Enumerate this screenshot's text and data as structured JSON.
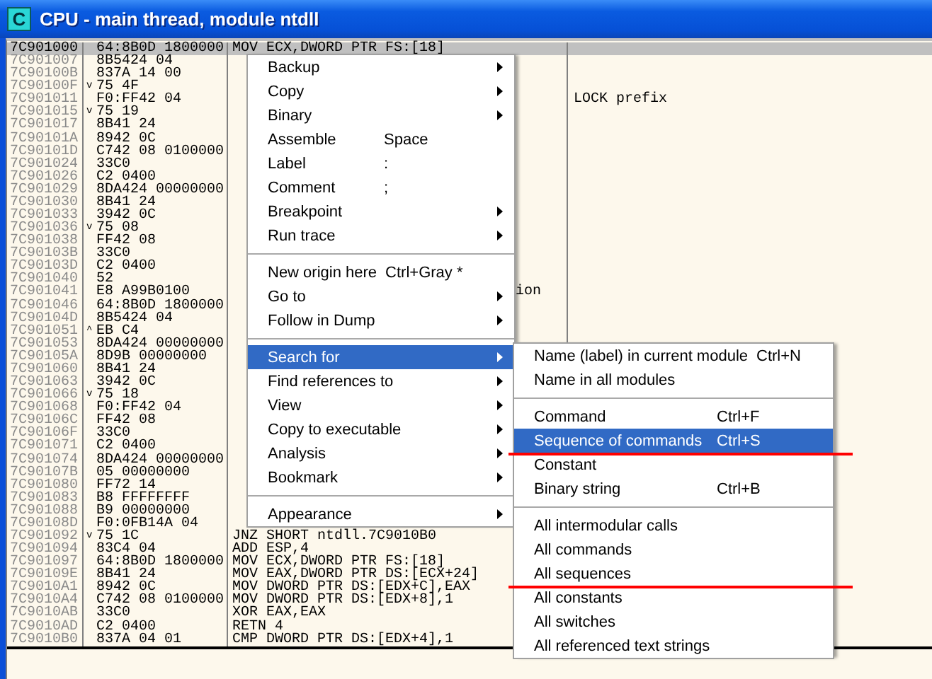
{
  "window": {
    "icon_letter": "C",
    "title": "CPU - main thread, module ntdll"
  },
  "rows": [
    {
      "addr": "7C901000",
      "hex": "64:8B0D 1800000",
      "disasm": "MOV ECX,DWORD PTR FS:[18]",
      "selected": true
    },
    {
      "addr": "7C901007",
      "hex": "8B5424 04",
      "selected": false
    },
    {
      "addr": "7C90100B",
      "hex": "837A 14 00",
      "selected": false
    },
    {
      "addr": "7C90100F",
      "hex": "75 4F",
      "jump": "v",
      "selected": false
    },
    {
      "addr": "7C901011",
      "hex": "F0:FF42 04",
      "comment": "LOCK prefix",
      "selected": false
    },
    {
      "addr": "7C901015",
      "hex": "75 19",
      "jump": "v",
      "selected": false
    },
    {
      "addr": "7C901017",
      "hex": "8B41 24",
      "selected": false
    },
    {
      "addr": "7C90101A",
      "hex": "8942 0C",
      "selected": false
    },
    {
      "addr": "7C90101D",
      "hex": "C742 08 0100000",
      "selected": false
    },
    {
      "addr": "7C901024",
      "hex": "33C0",
      "selected": false
    },
    {
      "addr": "7C901026",
      "hex": "C2 0400",
      "selected": false
    },
    {
      "addr": "7C901029",
      "hex": "8DA424 00000000",
      "selected": false
    },
    {
      "addr": "7C901030",
      "hex": "8B41 24",
      "selected": false
    },
    {
      "addr": "7C901033",
      "hex": "3942 0C",
      "selected": false
    },
    {
      "addr": "7C901036",
      "hex": "75 08",
      "jump": "v",
      "selected": false
    },
    {
      "addr": "7C901038",
      "hex": "FF42 08",
      "selected": false
    },
    {
      "addr": "7C90103B",
      "hex": "33C0",
      "selected": false
    },
    {
      "addr": "7C90103D",
      "hex": "C2 0400",
      "selected": false
    },
    {
      "addr": "7C901040",
      "hex": "52",
      "selected": false
    },
    {
      "addr": "7C901041",
      "hex": "E8 A99B0100",
      "disasm": "ion",
      "disasm_cut": true,
      "selected": false
    },
    {
      "addr": "7C901046",
      "hex": "64:8B0D 1800000",
      "selected": false
    },
    {
      "addr": "7C90104D",
      "hex": "8B5424 04",
      "selected": false
    },
    {
      "addr": "7C901051",
      "hex": "EB C4",
      "jump": "^",
      "selected": false
    },
    {
      "addr": "7C901053",
      "hex": "8DA424 00000000",
      "selected": false
    },
    {
      "addr": "7C90105A",
      "hex": "8D9B 00000000",
      "selected": false
    },
    {
      "addr": "7C901060",
      "hex": "8B41 24",
      "selected": false
    },
    {
      "addr": "7C901063",
      "hex": "3942 0C",
      "selected": false
    },
    {
      "addr": "7C901066",
      "hex": "75 18",
      "jump": "v",
      "selected": false
    },
    {
      "addr": "7C901068",
      "hex": "F0:FF42 04",
      "selected": false
    },
    {
      "addr": "7C90106C",
      "hex": "FF42 08",
      "selected": false
    },
    {
      "addr": "7C90106F",
      "hex": "33C0",
      "selected": false
    },
    {
      "addr": "7C901071",
      "hex": "C2 0400",
      "selected": false
    },
    {
      "addr": "7C901074",
      "hex": "8DA424 00000000",
      "selected": false
    },
    {
      "addr": "7C90107B",
      "hex": "05 00000000",
      "selected": false
    },
    {
      "addr": "7C901080",
      "hex": "FF72 14",
      "selected": false
    },
    {
      "addr": "7C901083",
      "hex": "B8 FFFFFFFF",
      "selected": false
    },
    {
      "addr": "7C901088",
      "hex": "B9 00000000",
      "selected": false
    },
    {
      "addr": "7C90108D",
      "hex": "F0:0FB14A 04",
      "selected": false
    },
    {
      "addr": "7C901092",
      "hex": "75 1C",
      "jump": "v",
      "disasm": "JNZ SHORT ntdll.7C9010B0",
      "selected": false
    },
    {
      "addr": "7C901094",
      "hex": "83C4 04",
      "disasm": "ADD ESP,4",
      "selected": false
    },
    {
      "addr": "7C901097",
      "hex": "64:8B0D 1800000",
      "disasm": "MOV ECX,DWORD PTR FS:[18]",
      "selected": false
    },
    {
      "addr": "7C90109E",
      "hex": "8B41 24",
      "disasm": "MOV EAX,DWORD PTR DS:[ECX+24]",
      "selected": false
    },
    {
      "addr": "7C9010A1",
      "hex": "8942 0C",
      "disasm": "MOV DWORD PTR DS:[EDX+C],EAX",
      "selected": false
    },
    {
      "addr": "7C9010A4",
      "hex": "C742 08 0100000",
      "disasm": "MOV DWORD PTR DS:[EDX+8],1",
      "selected": false
    },
    {
      "addr": "7C9010AB",
      "hex": "33C0",
      "disasm": "XOR EAX,EAX",
      "selected": false
    },
    {
      "addr": "7C9010AD",
      "hex": "C2 0400",
      "disasm": "RETN 4",
      "selected": false
    },
    {
      "addr": "7C9010B0",
      "hex": "837A 04 01",
      "disasm": "CMP DWORD PTR DS:[EDX+4],1",
      "selected": false
    }
  ],
  "context_menu": {
    "groups": [
      [
        {
          "label": "Backup",
          "submenu": true,
          "selected": false
        },
        {
          "label": "Copy",
          "submenu": true,
          "selected": false
        },
        {
          "label": "Binary",
          "submenu": true,
          "selected": false
        },
        {
          "label": "Assemble",
          "shortcut": "Space",
          "selected": false
        },
        {
          "label": "Label",
          "shortcut": ":",
          "selected": false
        },
        {
          "label": "Comment",
          "shortcut": ";",
          "selected": false
        },
        {
          "label": "Breakpoint",
          "submenu": true,
          "selected": false
        },
        {
          "label": "Run trace",
          "submenu": true,
          "selected": false
        }
      ],
      [
        {
          "label": "New origin here",
          "shortcut": "Ctrl+Gray *",
          "selected": false
        },
        {
          "label": "Go to",
          "submenu": true,
          "selected": false
        },
        {
          "label": "Follow in Dump",
          "submenu": true,
          "selected": false
        }
      ],
      [
        {
          "label": "Search for",
          "submenu": true,
          "selected": true
        },
        {
          "label": "Find references to",
          "submenu": true,
          "selected": false
        },
        {
          "label": "View",
          "submenu": true,
          "selected": false
        },
        {
          "label": "Copy to executable",
          "submenu": true,
          "selected": false
        },
        {
          "label": "Analysis",
          "submenu": true,
          "selected": false
        },
        {
          "label": "Bookmark",
          "submenu": true,
          "selected": false
        }
      ],
      [
        {
          "label": "Appearance",
          "submenu": true,
          "selected": false
        }
      ]
    ]
  },
  "search_submenu": {
    "groups": [
      [
        {
          "label": "Name (label) in current module",
          "shortcut": "Ctrl+N",
          "selected": false,
          "underlined": false
        },
        {
          "label": "Name in all modules",
          "selected": false,
          "underlined": false
        }
      ],
      [
        {
          "label": "Command",
          "shortcut": "Ctrl+F",
          "selected": false,
          "underlined": false
        },
        {
          "label": "Sequence of commands",
          "shortcut": "Ctrl+S",
          "selected": true,
          "underlined": true
        },
        {
          "label": "Constant",
          "selected": false,
          "underlined": false
        },
        {
          "label": "Binary string",
          "shortcut": "Ctrl+B",
          "selected": false,
          "underlined": false
        }
      ],
      [
        {
          "label": "All intermodular calls",
          "selected": false,
          "underlined": false
        },
        {
          "label": "All commands",
          "selected": false,
          "underlined": false
        },
        {
          "label": "All sequences",
          "selected": false,
          "underlined": true
        },
        {
          "label": "All constants",
          "selected": false,
          "underlined": false
        },
        {
          "label": "All switches",
          "selected": false,
          "underlined": false
        },
        {
          "label": "All referenced text strings",
          "selected": false,
          "underlined": false
        }
      ]
    ]
  }
}
